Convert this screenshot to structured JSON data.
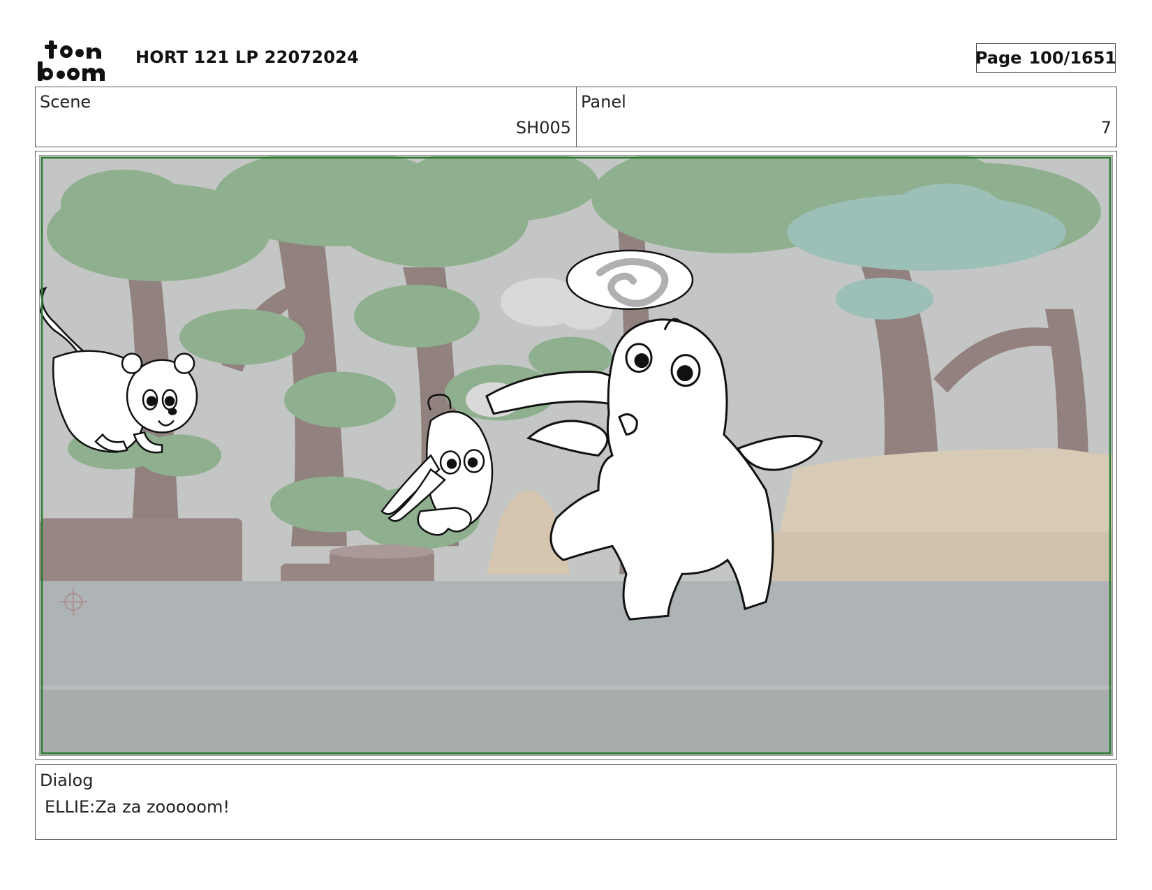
{
  "header": {
    "logo_text": "toon boom",
    "title": "HORT 121 LP 22072024",
    "page_label": "Page",
    "page_number": "100/1651"
  },
  "info": {
    "scene_label": "Scene",
    "scene_value": "SH005",
    "panel_label": "Panel",
    "panel_value": "7"
  },
  "panel_image": {
    "characters": [
      "bear-cub",
      "bunny-hanging-from-trunk",
      "baby-elephant"
    ],
    "props": [
      "swirl-speech-bubble"
    ],
    "background": "jungle-3d-render"
  },
  "dialog": {
    "label": "Dialog",
    "text": "ELLIE:Za za zooooom!"
  },
  "colors": {
    "frame_border": "#2e7d32",
    "ground": "#aeb4b5",
    "foliage": "#8fb08e",
    "trunk": "#8a7573"
  }
}
